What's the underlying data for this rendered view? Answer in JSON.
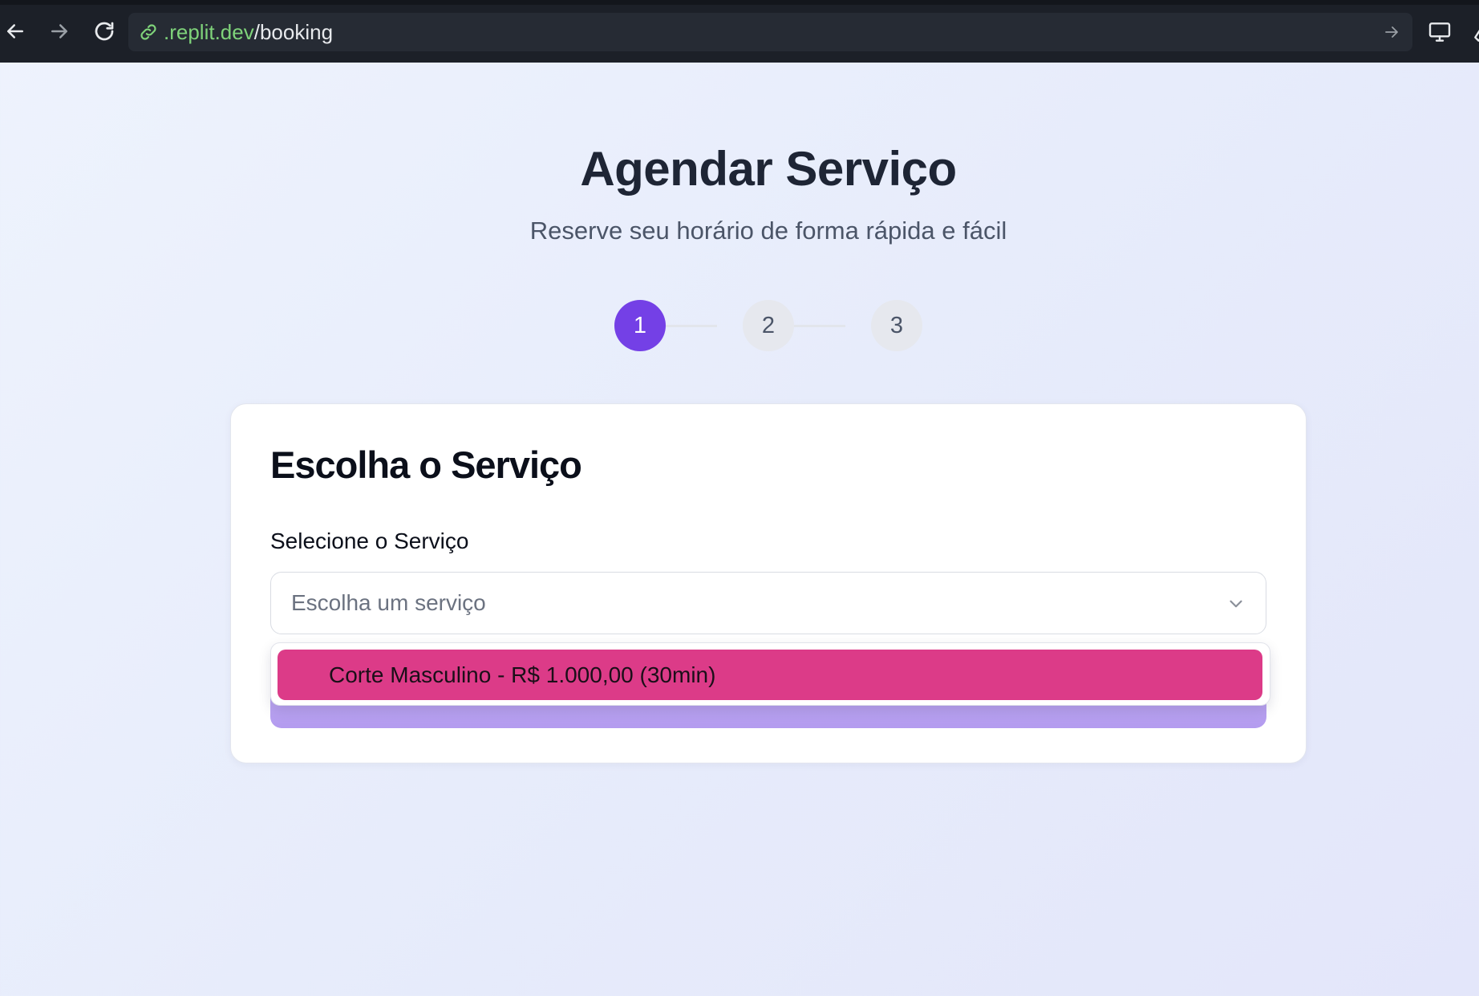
{
  "browser": {
    "url_domain": ".replit.dev",
    "url_path": "/booking"
  },
  "header": {
    "title": "Agendar Serviço",
    "subtitle": "Reserve seu horário de forma rápida e fácil"
  },
  "stepper": {
    "steps": [
      "1",
      "2",
      "3"
    ],
    "active_step": 1,
    "active_color": "#7440e6"
  },
  "card": {
    "title": "Escolha o Serviço",
    "field_label": "Selecione o Serviço",
    "select_placeholder": "Escolha um serviço"
  },
  "dropdown": {
    "options": [
      "Corte Masculino - R$ 1.000,00 (30min)"
    ],
    "highlight_color": "#dc3b88"
  },
  "icons": {
    "back": "arrow-left-icon",
    "forward": "arrow-right-icon",
    "reload": "reload-icon",
    "link": "link-icon",
    "go": "arrow-right-icon",
    "device": "monitor-icon",
    "tool": "wrench-icon",
    "chevron": "chevron-down-icon"
  }
}
